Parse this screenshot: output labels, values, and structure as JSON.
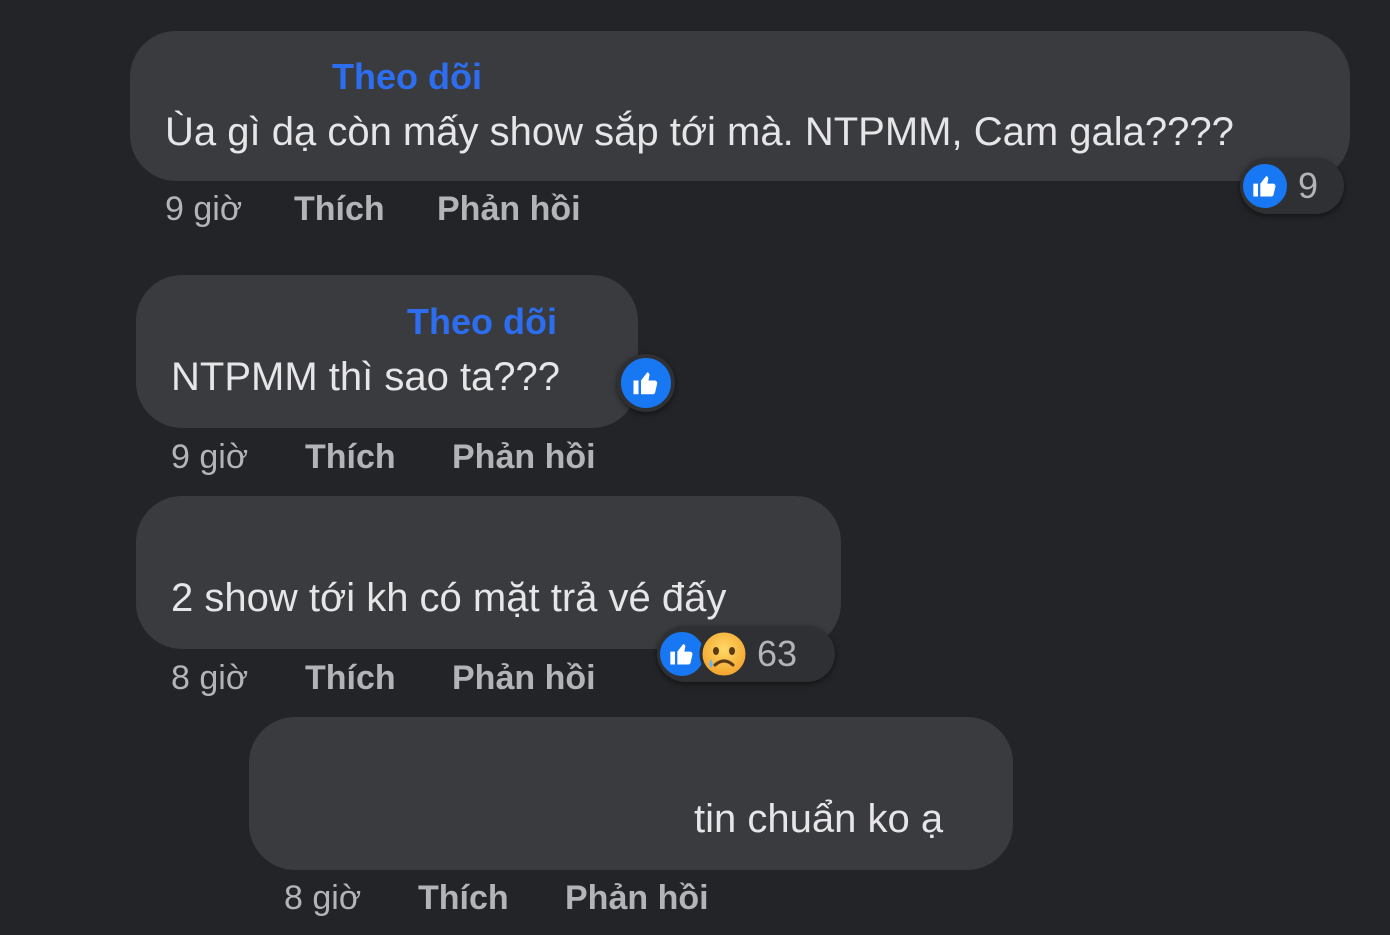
{
  "comments": [
    {
      "follow": "Theo dõi",
      "text": "Ùa gì dạ còn mấy show sắp tới mà. NTPMM, Cam gala????",
      "time": "9 giờ",
      "like": "Thích",
      "reply": "Phản hồi",
      "reaction_count": "9"
    },
    {
      "follow": "Theo dõi",
      "text": "NTPMM thì sao ta???",
      "time": "9 giờ",
      "like": "Thích",
      "reply": "Phản hồi"
    },
    {
      "text": "2 show tới kh có mặt trả vé đấy",
      "time": "8 giờ",
      "like": "Thích",
      "reply": "Phản hồi",
      "reaction_count": "63"
    },
    {
      "text": "tin chuẩn ko ạ",
      "time": "8 giờ",
      "like": "Thích",
      "reply": "Phản hồi"
    }
  ],
  "colors": {
    "background": "#232427",
    "bubble": "#3a3b3e",
    "follow_link": "#2d6ef0",
    "like_blue": "#1877f2",
    "text": "#e6e6e8",
    "meta": "#b3b4b8"
  },
  "icons": [
    "thumbs-up-icon",
    "sad-face-icon"
  ]
}
